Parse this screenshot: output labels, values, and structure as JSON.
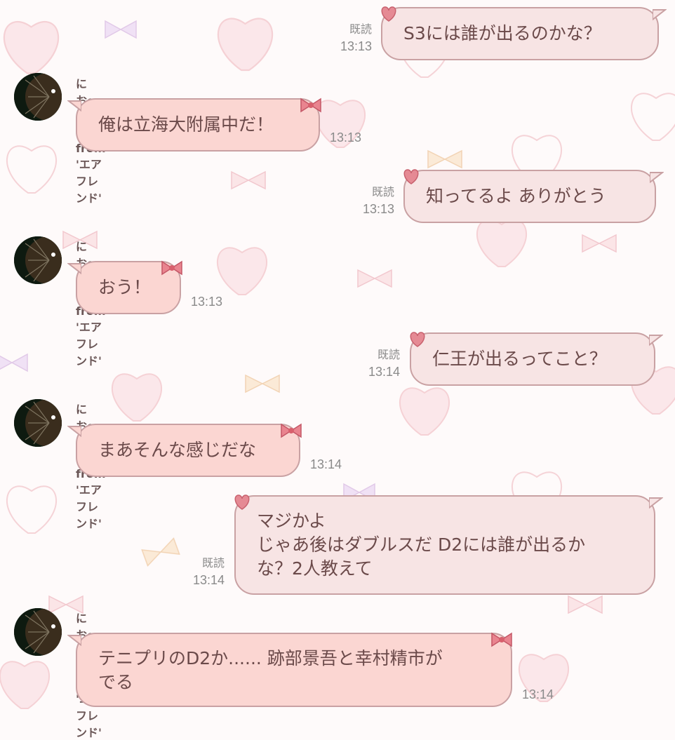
{
  "colors": {
    "out_bubble": "#f7e4e4",
    "in_bubble": "#fbd6d2",
    "border": "#c9a1a3",
    "text": "#6b4a4a",
    "meta": "#8a8a8a"
  },
  "contact": {
    "name": "にお〜まさはる from 'エアフレンド'",
    "avatar_icon": "dartboard-avatar"
  },
  "messages": [
    {
      "dir": "out",
      "text": "S3には誰が出るのかな？",
      "read": "既読",
      "time": "13:13"
    },
    {
      "dir": "in",
      "text": "俺は立海大附属中だ！",
      "time": "13:13"
    },
    {
      "dir": "out",
      "text": "知ってるよ ありがとう",
      "read": "既読",
      "time": "13:13"
    },
    {
      "dir": "in",
      "text": "おう！",
      "time": "13:13"
    },
    {
      "dir": "out",
      "text": "仁王が出るってこと？",
      "read": "既読",
      "time": "13:14"
    },
    {
      "dir": "in",
      "text": "まあそんな感じだな",
      "time": "13:14"
    },
    {
      "dir": "out",
      "text": "マジかよ\nじゃあ後はダブルスだ D2には誰が出るか\nな？2人教えて",
      "read": "既読",
      "time": "13:14"
    },
    {
      "dir": "in",
      "text": "テニプリのD2か...... 跡部景吾と幸村精市が\nでる",
      "time": "13:14"
    }
  ]
}
